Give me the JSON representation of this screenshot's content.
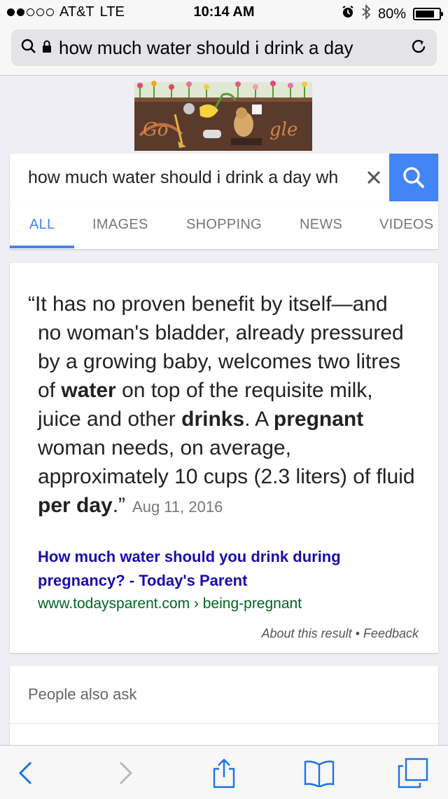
{
  "status_bar": {
    "carrier": "AT&T",
    "network": "LTE",
    "time": "10:14 AM",
    "battery_percent": "80%",
    "battery_level": 0.8,
    "signal_bars_filled": 2,
    "signal_bars_total": 5,
    "icons": [
      "alarm-icon",
      "bluetooth-icon",
      "battery-icon"
    ]
  },
  "address_bar": {
    "url_text": "how much water should i drink a day",
    "icons": [
      "search-icon",
      "lock-icon",
      "reload-icon"
    ]
  },
  "search": {
    "query": "how much water should i drink a day wh",
    "clear_symbol": "✕"
  },
  "tabs": [
    {
      "label": "ALL",
      "active": true
    },
    {
      "label": "IMAGES",
      "active": false
    },
    {
      "label": "SHOPPING",
      "active": false
    },
    {
      "label": "NEWS",
      "active": false
    },
    {
      "label": "VIDEOS",
      "active": false
    }
  ],
  "featured_snippet": {
    "quote_lines": [
      "“It has no proven benefit by itself—and",
      "no woman's bladder, already pressured",
      "by a growing baby, welcomes two litres",
      "of |water| on top of the requisite milk,",
      "juice and other |drinks|. A |pregnant|",
      "woman needs, on average,",
      "approximately 10 cups (2.3 liters) of fluid",
      "|per day|.”"
    ],
    "date": "Aug 11, 2016",
    "title_line1": "How much water should you drink during",
    "title_line2": "pregnancy? - Today's Parent",
    "url": "www.todaysparent.com › being-pregnant",
    "about": "About this result",
    "separator": "•",
    "feedback": "Feedback"
  },
  "people_also_ask": {
    "title": "People also ask"
  },
  "colors": {
    "google_blue": "#4285f4",
    "link_title": "#1a0dab",
    "url_green": "#006621"
  },
  "toolbar": {
    "icons": [
      "back-icon",
      "forward-icon",
      "share-icon",
      "bookmarks-icon",
      "tabs-icon"
    ]
  }
}
